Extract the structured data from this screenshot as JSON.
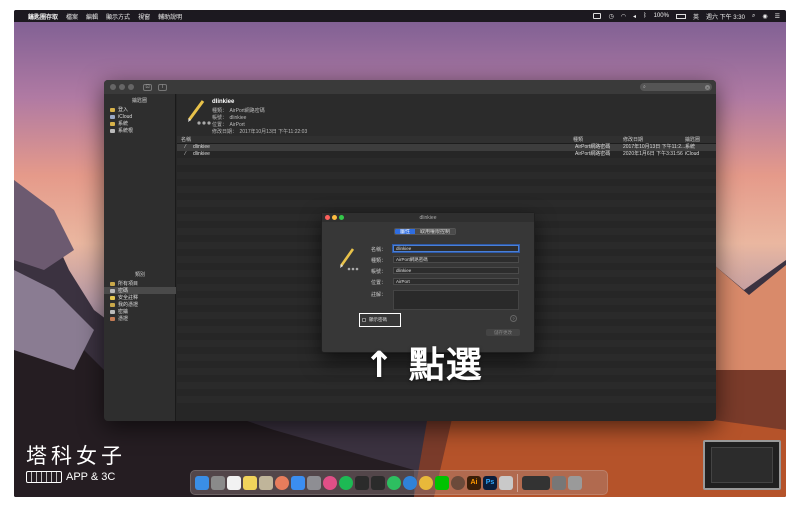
{
  "menubar": {
    "app_name": "鑰匙圈存取",
    "menus": [
      "檔案",
      "編輯",
      "顯示方式",
      "視窗",
      "輔助說明"
    ],
    "battery": "100%",
    "clock": "週六 下午 3:30",
    "input_method": "英"
  },
  "toolbar": {
    "search_placeholder": ""
  },
  "sidebar": {
    "keychains_header": "鑰匙圈",
    "keychains": [
      {
        "label": "登入",
        "color": "#d7b24a"
      },
      {
        "label": "iCloud",
        "color": "#9aa9c7"
      },
      {
        "label": "系統",
        "color": "#d7b24a"
      },
      {
        "label": "系統根",
        "color": "#bbbbbb"
      }
    ],
    "category_header": "類別",
    "categories": [
      {
        "label": "所有項目",
        "color": "#c9a84a"
      },
      {
        "label": "密碼",
        "color": "#bbbbbb"
      },
      {
        "label": "安全註釋",
        "color": "#e6c84f"
      },
      {
        "label": "我的憑證",
        "color": "#c9a84a"
      },
      {
        "label": "密鑰",
        "color": "#bbbbbb"
      },
      {
        "label": "憑證",
        "color": "#c47c55"
      }
    ],
    "selected_category": 1
  },
  "info_panel": {
    "title": "dlinkiee",
    "kind": "種類：　AirPort網路密碼",
    "account": "帳號：　dlinkiee",
    "where": "位置：　AirPort",
    "modified": "修改日期：　2017年10月13日 下午11:22:03"
  },
  "table": {
    "columns": [
      "名稱",
      "種類",
      "修改日期",
      "鑰匙圈"
    ],
    "rows": [
      {
        "name": "dlinkiee",
        "kind": "AirPort網路密碼",
        "date": "2017年10月13日 下午11:2...",
        "keychain": "系統"
      },
      {
        "name": "dlinkiee",
        "kind": "AirPort網路密碼",
        "date": "2020年1月6日 下午3:31:56",
        "keychain": "iCloud"
      }
    ]
  },
  "dialog": {
    "title": "dlinkiee",
    "tab_attributes": "屬性",
    "tab_access": "取用權限控制",
    "labels": {
      "name": "名稱：",
      "kind": "種類：",
      "account": "帳號：",
      "where": "位置：",
      "comments": "註解："
    },
    "values": {
      "name": "dlinkiee",
      "kind": "AirPort網路密碼",
      "account": "dlinkiee",
      "where": "AirPort",
      "comments": ""
    },
    "show_password": "顯示密碼",
    "save_button": "儲存更改"
  },
  "annotation": "↑ 點選",
  "watermark": {
    "title": "塔科女子",
    "subtitle": "APP & 3C"
  },
  "dock": {
    "apps": [
      {
        "name": "finder",
        "color": "#3a8ee6"
      },
      {
        "name": "launchpad",
        "color": "#8a8a8a"
      },
      {
        "name": "calendar",
        "color": "#f2f2f2"
      },
      {
        "name": "notes",
        "color": "#f1d35b"
      },
      {
        "name": "photos-folder",
        "color": "#c0b59a"
      },
      {
        "name": "photos",
        "color": "#e87d5c"
      },
      {
        "name": "app-store",
        "color": "#3b8ef1"
      },
      {
        "name": "system-preferences",
        "color": "#8e8e93"
      },
      {
        "name": "itunes",
        "color": "#e04f87"
      },
      {
        "name": "spotify",
        "color": "#1db954"
      },
      {
        "name": "terminal",
        "color": "#2b2b2b"
      },
      {
        "name": "activity-monitor",
        "color": "#2b2b2b"
      },
      {
        "name": "evernote",
        "color": "#2dbe60"
      },
      {
        "name": "safari",
        "color": "#2f82d9"
      },
      {
        "name": "chrome",
        "color": "#e8b83a"
      },
      {
        "name": "line",
        "color": "#00c300"
      },
      {
        "name": "davinci",
        "color": "#6b4a3a"
      },
      {
        "name": "illustrator",
        "color": "#3a1e08"
      },
      {
        "name": "photoshop",
        "color": "#0b1d3b"
      },
      {
        "name": "preview",
        "color": "#c9c9c9"
      }
    ],
    "illustrator_label": "Ai",
    "photoshop_label": "Ps"
  }
}
